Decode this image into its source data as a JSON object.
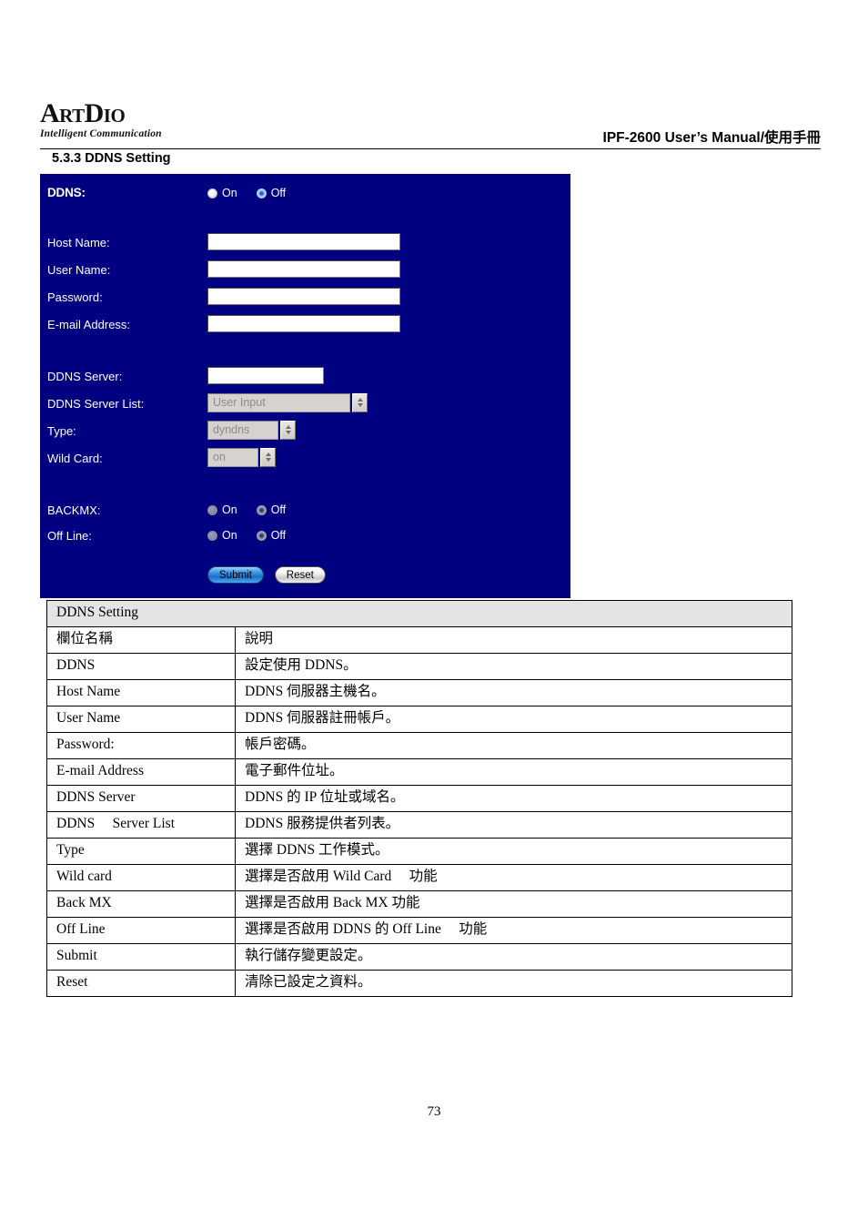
{
  "header": {
    "logo_primary_1": "A",
    "logo_primary_2": "RT",
    "logo_primary_3": "D",
    "logo_primary_4": "IO",
    "logo_tagline": "Intelligent Communication",
    "manual_title": "IPF-2600 User’s Manual/使用手冊"
  },
  "section": {
    "heading": "5.3.3 DDNS Setting"
  },
  "panel": {
    "rows": {
      "ddns_label": "DDNS:",
      "host_name_label": "Host Name:",
      "user_name_label": "User Name:",
      "password_label": "Password:",
      "email_label": "E-mail Address:",
      "ddns_server_label": "DDNS Server:",
      "ddns_server_list_label": "DDNS Server List:",
      "type_label": "Type:",
      "wild_card_label": "Wild Card:",
      "backmx_label": "BACKMX:",
      "off_line_label": "Off Line:"
    },
    "radio_on_label": "On",
    "radio_off_label": "Off",
    "values": {
      "host_name": "",
      "user_name": "",
      "password": "",
      "email": "",
      "ddns_server": "",
      "ddns_server_list": "User Input",
      "type": "dyndns",
      "wild_card": "on"
    },
    "selected": {
      "ddns": "Off",
      "backmx": "Off",
      "off_line": "Off"
    },
    "buttons": {
      "submit": "Submit",
      "reset": "Reset"
    },
    "colors": {
      "panel_background": "#000080",
      "submit_accent": "#1b6fc9"
    }
  },
  "table": {
    "caption": "DDNS Setting",
    "columns": [
      "欄位名稱",
      "說明"
    ],
    "rows": [
      {
        "name": "DDNS",
        "desc": "設定使用 DDNS。"
      },
      {
        "name": "Host Name",
        "desc": "DDNS 伺服器主機名。"
      },
      {
        "name": "User Name",
        "desc": "DDNS 伺服器註冊帳戶。"
      },
      {
        "name": "Password:",
        "desc": "帳戶密碼。"
      },
      {
        "name": "E-mail Address",
        "desc": "電子郵件位址。"
      },
      {
        "name": "DDNS Server",
        "desc": "DDNS 的 IP 位址或域名。"
      },
      {
        "name": "DDNS　 Server List",
        "desc": "DDNS 服務提供者列表。"
      },
      {
        "name": "Type",
        "desc": "選擇 DDNS 工作模式。"
      },
      {
        "name": "Wild card",
        "desc": "選擇是否啟用 Wild Card 　功能"
      },
      {
        "name": "Back MX",
        "desc": "選擇是否啟用 Back MX 功能"
      },
      {
        "name": "Off Line",
        "desc": "選擇是否啟用 DDNS 的 Off Line 　功能"
      },
      {
        "name": "Submit",
        "desc": "執行儲存變更設定。"
      },
      {
        "name": "Reset",
        "desc": "清除已設定之資料。"
      }
    ]
  },
  "footer": {
    "page_number": "73"
  }
}
